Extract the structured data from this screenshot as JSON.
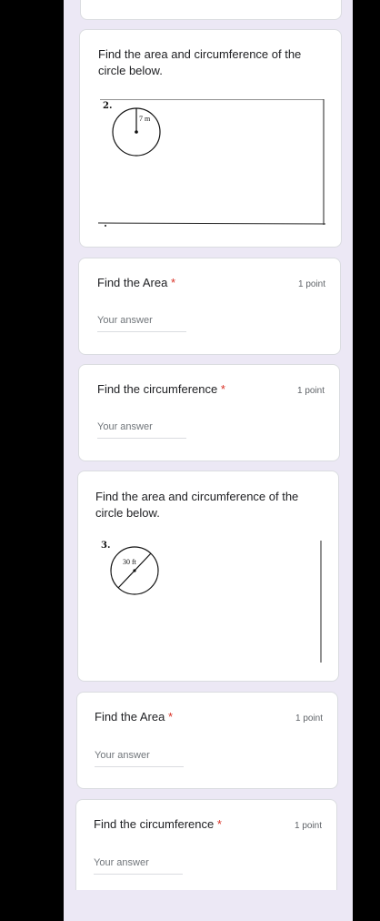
{
  "q_section2": {
    "description": "Find the area and circumference of the circle below.",
    "problem_number": "2.",
    "radius_label": "7 m"
  },
  "q_area_2": {
    "title": "Find the Area",
    "required": "*",
    "points": "1 point",
    "placeholder": "Your answer"
  },
  "q_circ_2": {
    "title": "Find the circumference",
    "required": "*",
    "points": "1 point",
    "placeholder": "Your answer"
  },
  "q_section3": {
    "description": "Find the area and circumference of the circle below.",
    "problem_number": "3.",
    "diameter_label": "30 ft"
  },
  "q_area_3": {
    "title": "Find the Area",
    "required": "*",
    "points": "1 point",
    "placeholder": "Your answer"
  },
  "q_circ_3": {
    "title": "Find the circumference",
    "required": "*",
    "points": "1 point",
    "placeholder": "Your answer"
  }
}
